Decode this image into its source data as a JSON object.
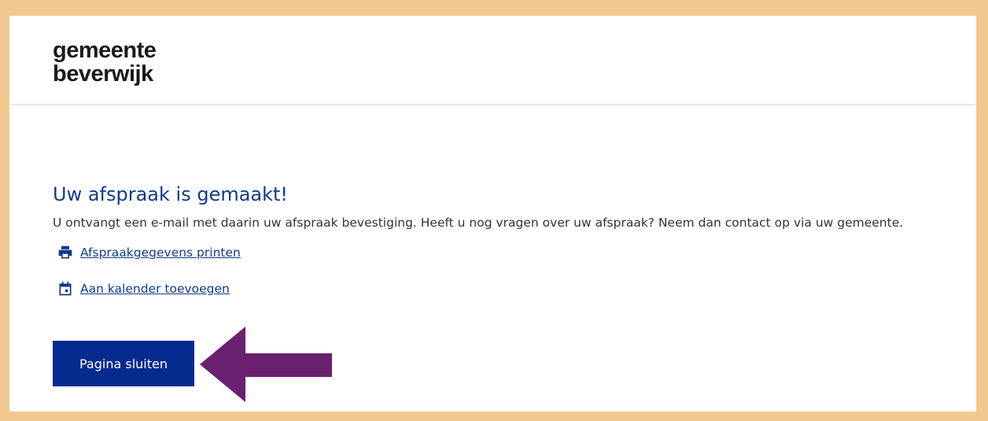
{
  "header": {
    "logo_line1": "gemeente",
    "logo_line2": "beverwijk"
  },
  "main": {
    "title": "Uw afspraak is gemaakt!",
    "description": "U ontvangt een e-mail met daarin uw afspraak bevestiging. Heeft u nog vragen over uw afspraak? Neem dan contact op via uw gemeente.",
    "links": [
      {
        "label": "Afspraakgegevens printen",
        "icon": "printer-icon"
      },
      {
        "label": "Aan kalender toevoegen",
        "icon": "calendar-icon"
      }
    ],
    "close_button_label": "Pagina sluiten"
  },
  "colors": {
    "frame_border": "#f3c88e",
    "primary": "#052b8f",
    "title": "#123a8a",
    "annotation_arrow": "#6b1f6f"
  }
}
